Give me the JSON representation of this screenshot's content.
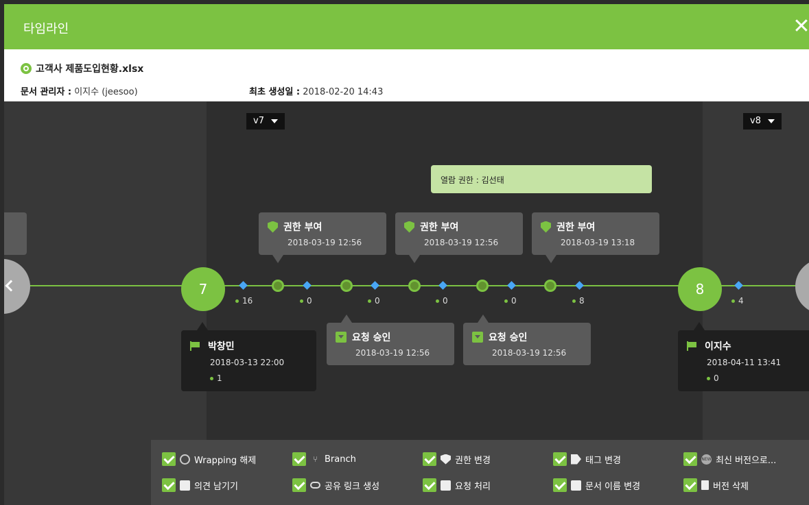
{
  "window": {
    "title": "타임라인",
    "close_icon": "close-icon"
  },
  "document": {
    "name": "고객사 제품도입현황.xlsx",
    "manager_label": "문서 관리자 :",
    "manager_value": "이지수 (jeesoo)",
    "created_label": "최초 생성일 :",
    "created_value": "2018-02-20 14:43"
  },
  "versions": [
    {
      "tag": "v7",
      "number": "7"
    },
    {
      "tag": "v8",
      "number": "8"
    }
  ],
  "counts": [
    "16",
    "0",
    "0",
    "0",
    "0",
    "8",
    "4"
  ],
  "tooltip": "열람 권한 : 김선태",
  "upper_events": [
    {
      "title": "권한 부여",
      "time": "2018-03-19 12:56"
    },
    {
      "title": "권한 부여",
      "time": "2018-03-19 12:56"
    },
    {
      "title": "권한 부여",
      "time": "2018-03-19 13:18"
    }
  ],
  "lower_events": [
    {
      "title": "요청 승인",
      "time": "2018-03-19 12:56"
    },
    {
      "title": "요청 승인",
      "time": "2018-03-19 12:56"
    }
  ],
  "users": [
    {
      "name": "박창민",
      "time": "2018-03-13 22:00",
      "count": "1"
    },
    {
      "name": "이지수",
      "time": "2018-04-11 13:41",
      "count": "0"
    }
  ],
  "legend": [
    {
      "label": "Wrapping 해제",
      "icon": "wrap-icon"
    },
    {
      "label": "Branch",
      "icon": "branch-icon"
    },
    {
      "label": "권한 변경",
      "icon": "shield-icon"
    },
    {
      "label": "태그 변경",
      "icon": "tag-icon"
    },
    {
      "label": "최신 버전으로...",
      "icon": "new-icon"
    },
    {
      "label": "의견 남기기",
      "icon": "comment-icon"
    },
    {
      "label": "공유 링크 생성",
      "icon": "link-icon"
    },
    {
      "label": "요청 처리",
      "icon": "inbox-icon"
    },
    {
      "label": "문서 이름 변경",
      "icon": "rename-icon"
    },
    {
      "label": "버전 삭제",
      "icon": "trash-icon"
    }
  ],
  "colors": {
    "accent": "#7cc242",
    "diamond": "#49a6f5",
    "tooltip_bg": "#c5e3a4"
  }
}
